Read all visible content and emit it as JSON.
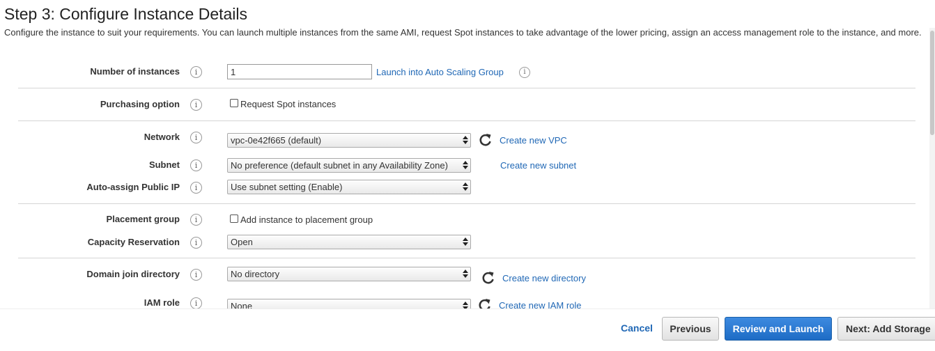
{
  "page": {
    "title": "Step 3: Configure Instance Details",
    "description": "Configure the instance to suit your requirements. You can launch multiple instances from the same AMI, request Spot instances to take advantage of the lower pricing, assign an access management role to the instance, and more."
  },
  "icons": {
    "info": "i"
  },
  "fields": {
    "instances": {
      "label": "Number of instances",
      "value": "1",
      "link": "Launch into Auto Scaling Group"
    },
    "purchasing": {
      "label": "Purchasing option",
      "checkbox_label": "Request Spot instances"
    },
    "network": {
      "label": "Network",
      "value": "vpc-0e42f665 (default)",
      "link": "Create new VPC"
    },
    "subnet": {
      "label": "Subnet",
      "value": "No preference (default subnet in any Availability Zone)",
      "link": "Create new subnet"
    },
    "public_ip": {
      "label": "Auto-assign Public IP",
      "value": "Use subnet setting (Enable)"
    },
    "placement": {
      "label": "Placement group",
      "checkbox_label": "Add instance to placement group"
    },
    "capacity": {
      "label": "Capacity Reservation",
      "value": "Open"
    },
    "domain": {
      "label": "Domain join directory",
      "value": "No directory",
      "link": "Create new directory"
    },
    "iam": {
      "label": "IAM role",
      "value": "None",
      "link": "Create new IAM role"
    }
  },
  "footer": {
    "cancel": "Cancel",
    "previous": "Previous",
    "review": "Review and Launch",
    "next": "Next: Add Storage"
  },
  "colors": {
    "link": "#1f67b5",
    "primary_button": "#1e6cc5"
  }
}
